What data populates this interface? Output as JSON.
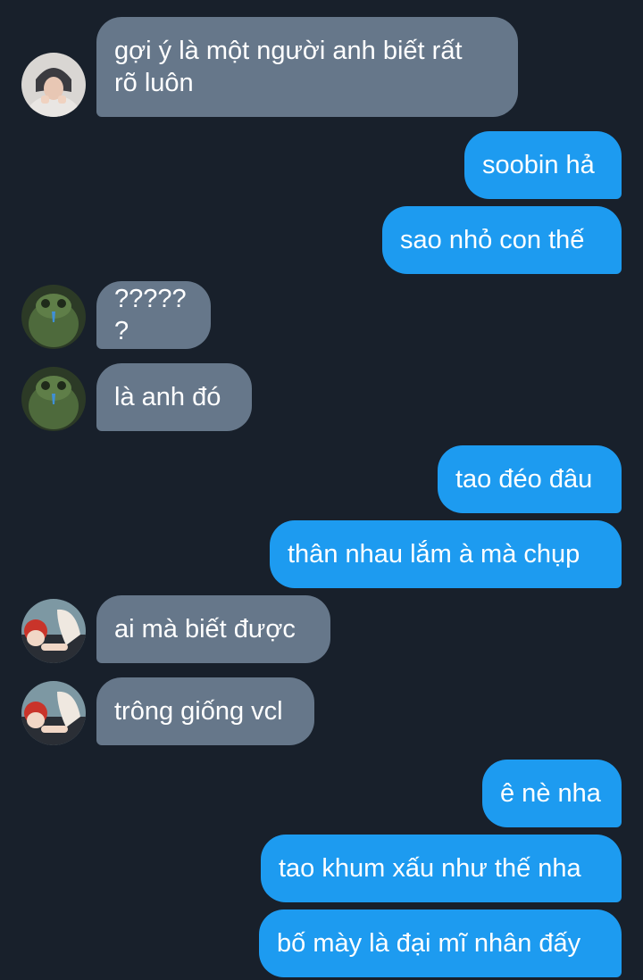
{
  "conversation": {
    "messages": [
      {
        "sender": "them",
        "avatar": "avatar-person-hoodie",
        "text": "gợi ý là một người anh biết rất\nrõ luôn"
      },
      {
        "sender": "me",
        "text": "soobin hả"
      },
      {
        "sender": "me",
        "text": "sao nhỏ con thế"
      },
      {
        "sender": "them",
        "avatar": "avatar-green-frog",
        "text": "??????"
      },
      {
        "sender": "them",
        "avatar": "avatar-green-frog",
        "text": "là anh đó"
      },
      {
        "sender": "me",
        "text": "tao đéo đâu"
      },
      {
        "sender": "me",
        "text": "thân nhau lắm à mà chụp"
      },
      {
        "sender": "them",
        "avatar": "avatar-anime-characters",
        "text": "ai mà biết được"
      },
      {
        "sender": "them",
        "avatar": "avatar-anime-characters",
        "text": "trông giống vcl"
      },
      {
        "sender": "me",
        "text": "ê nè nha"
      },
      {
        "sender": "me",
        "text": "tao khum xấu như thế nha"
      },
      {
        "sender": "me",
        "text": "bố mày là đại mĩ nhân đấy"
      }
    ]
  },
  "colors": {
    "background": "#18202b",
    "incoming_bubble": "#66778a",
    "outgoing_bubble": "#1d9bf0",
    "text": "#ffffff"
  }
}
